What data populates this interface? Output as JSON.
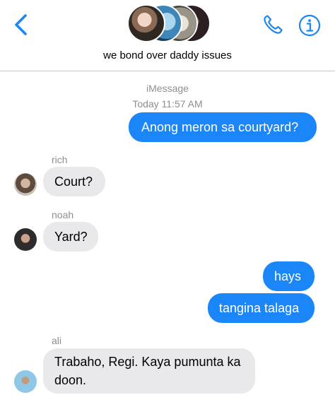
{
  "header": {
    "group_title": "we bond over daddy issues",
    "back_icon": "chevron-left-icon",
    "call_icon": "phone-icon",
    "info_icon": "info-icon",
    "accent_color": "#1b86f8"
  },
  "conversation": {
    "service_label": "iMessage",
    "timestamp": "Today 11:57 AM"
  },
  "messages": [
    {
      "direction": "outgoing",
      "text": "Anong meron sa courtyard?"
    },
    {
      "direction": "incoming",
      "sender": "rich",
      "text": "Court?"
    },
    {
      "direction": "incoming",
      "sender": "noah",
      "text": "Yard?"
    },
    {
      "direction": "outgoing",
      "text": "hays"
    },
    {
      "direction": "outgoing",
      "text": "tangina talaga"
    },
    {
      "direction": "incoming",
      "sender": "ali",
      "text_line1": "Trabaho, Regi. Kaya pumunta ka",
      "text_line2": "doon."
    }
  ],
  "colors": {
    "outgoing_bubble": "#1b86f8",
    "incoming_bubble": "#e9e9eb",
    "meta_text": "#8e8e93"
  }
}
